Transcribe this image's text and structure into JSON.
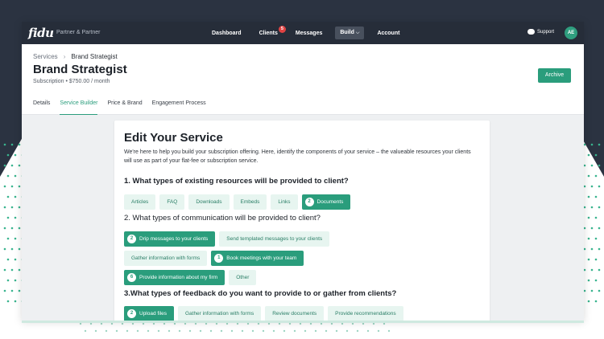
{
  "app": {
    "logo": "fidu",
    "org": "Partner & Partner"
  },
  "nav": {
    "items": [
      {
        "label": "Dashboard"
      },
      {
        "label": "Clients",
        "badge": "5"
      },
      {
        "label": "Messages"
      },
      {
        "label": "Build",
        "active": true
      },
      {
        "label": "Account"
      }
    ],
    "support_label": "Support",
    "avatar_initials": "AE"
  },
  "header": {
    "breadcrumb": {
      "parent": "Services",
      "current": "Brand Strategist"
    },
    "title": "Brand Strategist",
    "subtitle": "Subscription • $750.00 / month",
    "archive_label": "Archive",
    "tabs": [
      {
        "label": "Details"
      },
      {
        "label": "Service Builder",
        "active": true
      },
      {
        "label": "Price & Brand"
      },
      {
        "label": "Engagement Process"
      }
    ]
  },
  "card": {
    "title": "Edit Your Service",
    "intro": "We're here to help you build your subscription offering. Here, identify the components of your service – the valueable resources your clients will use as part of your flat-fee or subscription service.",
    "q1": {
      "label": "1. What types of existing resources will be provided to client?",
      "chips": [
        {
          "label": "Articles"
        },
        {
          "label": "FAQ"
        },
        {
          "label": "Downloads"
        },
        {
          "label": "Embeds"
        },
        {
          "label": "Links"
        },
        {
          "label": "Documents",
          "selected": "2"
        }
      ]
    },
    "q2": {
      "label": "2. What types of communication will be provided to client?",
      "rows": [
        [
          {
            "label": "Drip messages to your clients",
            "selected": "2"
          },
          {
            "label": "Send templated messages to your clients"
          }
        ],
        [
          {
            "label": "Gather information with forms"
          },
          {
            "label": "Book meetings with your team",
            "selected": "1"
          }
        ],
        [
          {
            "label": "Provide information about my firm",
            "selected": "6"
          },
          {
            "label": "Other"
          }
        ]
      ]
    },
    "q3": {
      "label": "3.What types of feedback do you want to provide to or gather from clients?",
      "chips": [
        {
          "label": "Upload files",
          "selected": "2"
        },
        {
          "label": "Gather information with forms"
        },
        {
          "label": "Review documents"
        },
        {
          "label": "Provide recommendations"
        }
      ]
    }
  },
  "colors": {
    "accent": "#2a9d7c",
    "chip_bg": "#e7f5f0",
    "topbar": "#262d39",
    "badge": "#e04343"
  }
}
